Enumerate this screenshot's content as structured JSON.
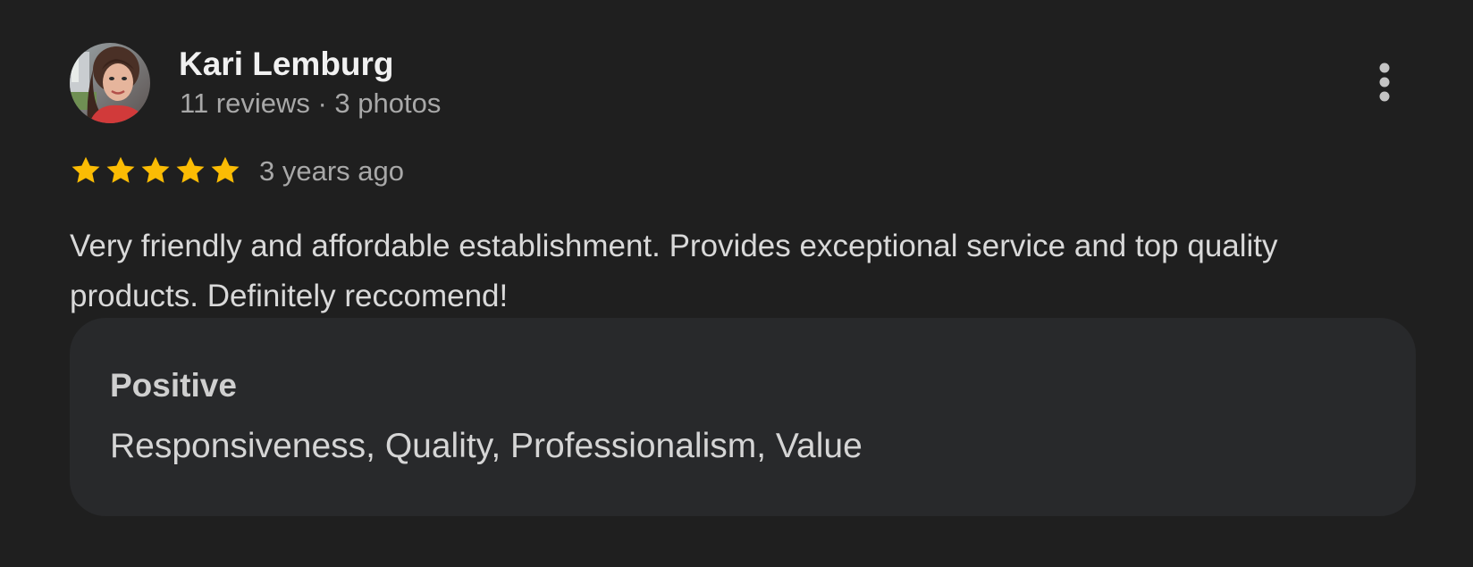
{
  "reviewer": {
    "name": "Kari Lemburg",
    "meta": "11 reviews · 3 photos"
  },
  "review": {
    "rating": 5,
    "max_rating": 5,
    "time": "3 years ago",
    "text": "Very friendly and affordable establishment. Provides exceptional service and top quality products. Definitely reccomend!"
  },
  "attributes": {
    "heading": "Positive",
    "values": "Responsiveness, Quality, Professionalism, Value"
  },
  "icons": {
    "more": "more-vert-icon",
    "star": "star-icon"
  },
  "colors": {
    "background": "#1f1f1f",
    "panel": "#28292b",
    "star": "#fbbc04",
    "secondary_text": "#a8a8a8"
  }
}
